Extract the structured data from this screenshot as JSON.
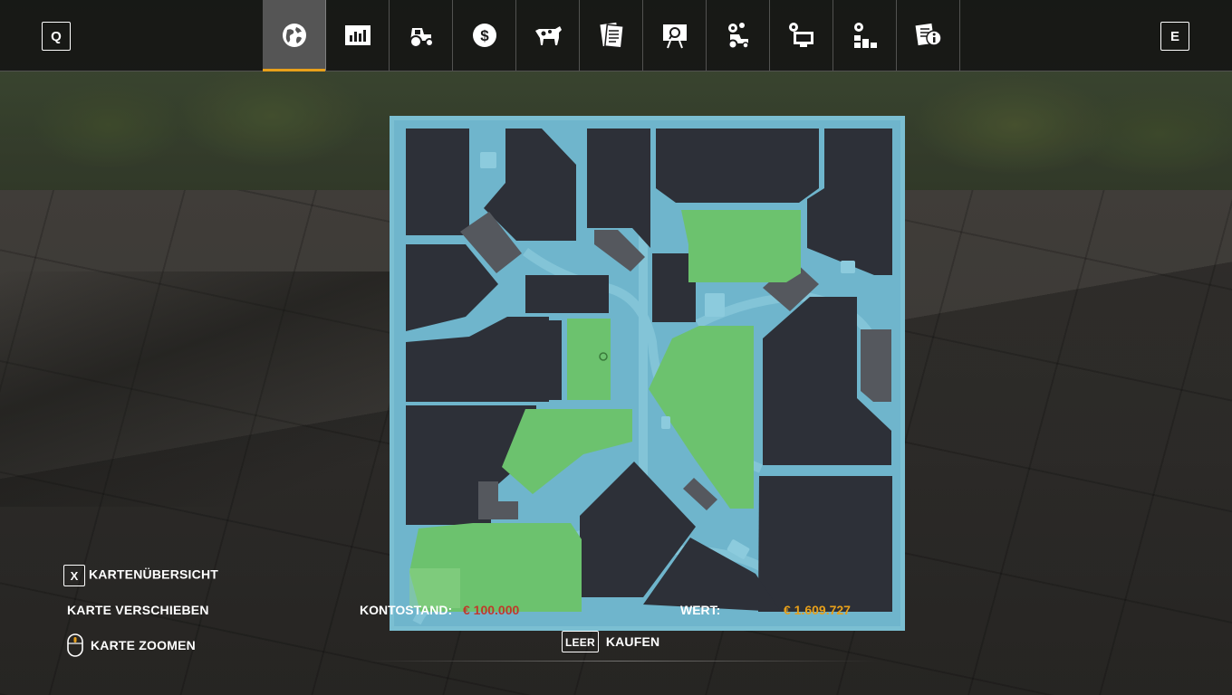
{
  "topbar": {
    "left_key": "Q",
    "right_key": "E",
    "tabs": [
      {
        "icon": "globe-map-icon",
        "active": true
      },
      {
        "icon": "statistics-chart-icon",
        "active": false
      },
      {
        "icon": "tractor-icon",
        "active": false
      },
      {
        "icon": "dollar-coin-icon",
        "active": false
      },
      {
        "icon": "cow-icon",
        "active": false
      },
      {
        "icon": "contracts-papers-icon",
        "active": false
      },
      {
        "icon": "presentation-board-icon",
        "active": false
      },
      {
        "icon": "tractor-settings-icon",
        "active": false
      },
      {
        "icon": "monitor-settings-icon",
        "active": false
      },
      {
        "icon": "gear-boxes-icon",
        "active": false
      },
      {
        "icon": "help-info-papers-icon",
        "active": false
      }
    ]
  },
  "controls": {
    "overview_key": "X",
    "overview_label": "KARTENÜBERSICHT",
    "move_label": "KARTE VERSCHIEBEN",
    "zoom_label": "KARTE ZOOMEN",
    "buy_key": "LEER",
    "buy_label": "KAUFEN"
  },
  "finance": {
    "balance_label": "KONTOSTAND:",
    "balance_value": "€ 100.000",
    "value_label": "WERT:",
    "value_value": "€ 1.609.727"
  },
  "colors": {
    "map_water": "#6fb5cc",
    "field_dark": "#2d3038",
    "field_owned": "#6cc26e",
    "active_tab_accent": "#e8a01a",
    "balance_color": "#c0392b",
    "value_color": "#e8a01a"
  }
}
